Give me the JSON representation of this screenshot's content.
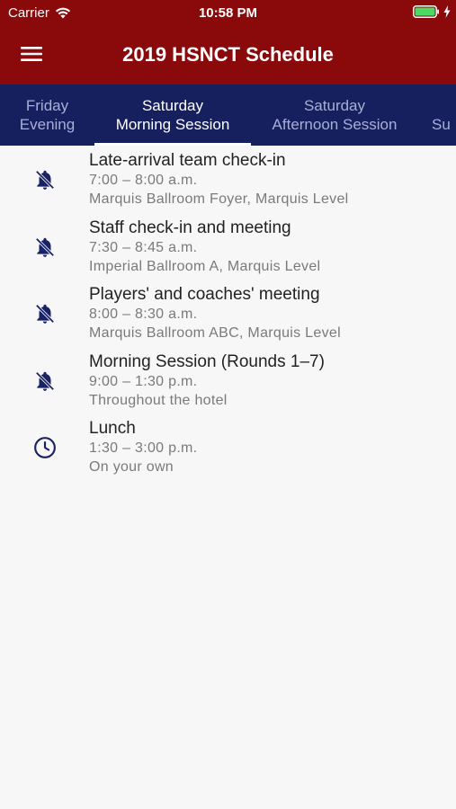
{
  "status_bar": {
    "carrier": "Carrier",
    "time": "10:58 PM",
    "battery_color": "#4cd964"
  },
  "header": {
    "title": "2019 HSNCT Schedule",
    "background": "#8a0a0c",
    "menu_icon": "hamburger-menu-icon"
  },
  "tabs": [
    {
      "line1": "Friday",
      "line2": "Evening",
      "active": false
    },
    {
      "line1": "Saturday",
      "line2": "Morning Session",
      "active": true
    },
    {
      "line1": "Saturday",
      "line2": "Afternoon Session",
      "active": false
    },
    {
      "line1": "Su",
      "line2": "",
      "active": false
    }
  ],
  "tab_bar_color": "#17205e",
  "events": [
    {
      "title": "Late-arrival team check-in",
      "time": "7:00 – 8:00 a.m.",
      "location": "Marquis Ballroom Foyer, Marquis Level",
      "icon": "bell-off-icon"
    },
    {
      "title": "Staff check-in and meeting",
      "time": "7:30 – 8:45 a.m.",
      "location": "Imperial Ballroom A, Marquis Level",
      "icon": "bell-off-icon"
    },
    {
      "title": "Players' and coaches' meeting",
      "time": "8:00 – 8:30 a.m.",
      "location": "Marquis Ballroom ABC, Marquis Level",
      "icon": "bell-off-icon"
    },
    {
      "title": "Morning Session (Rounds 1–7)",
      "time": "9:00 – 1:30 p.m.",
      "location": "Throughout the hotel",
      "icon": "bell-off-icon"
    },
    {
      "title": "Lunch",
      "time": "1:30 – 3:00 p.m.",
      "location": "On your own",
      "icon": "clock-icon"
    }
  ],
  "icon_color": "#1a2266"
}
